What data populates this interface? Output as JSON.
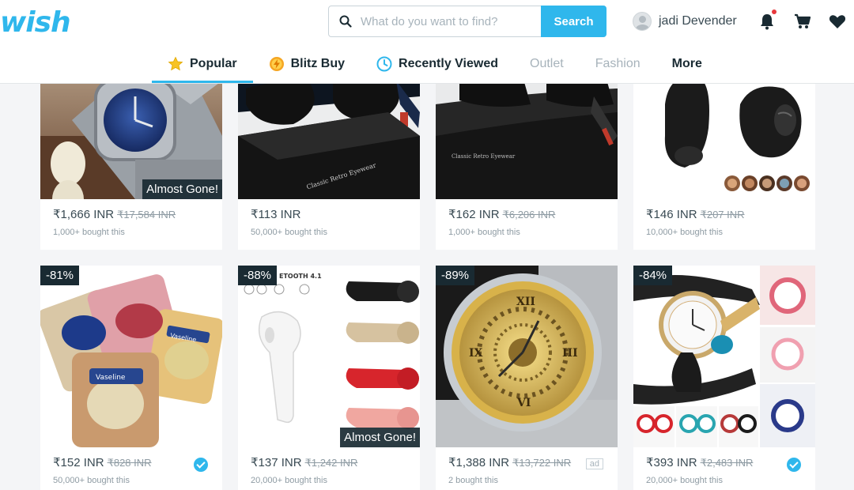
{
  "header": {
    "logo": "wish",
    "search": {
      "placeholder": "What do you want to find?",
      "button": "Search"
    },
    "user_name": "jadi Devender"
  },
  "tabs": [
    {
      "label": "Popular",
      "icon": "star-icon"
    },
    {
      "label": "Blitz Buy",
      "icon": "blitz-coin-icon"
    },
    {
      "label": "Recently Viewed",
      "icon": "clock-icon"
    },
    {
      "label": "Outlet"
    },
    {
      "label": "Fashion"
    },
    {
      "label": "More"
    }
  ],
  "products": [
    {
      "name": "watch",
      "price": "₹1,666 INR",
      "old_price": "₹17,584 INR",
      "bought": "1,000+ bought this",
      "badge": "Almost Gone!"
    },
    {
      "name": "sunglasses-box",
      "price": "₹113 INR",
      "bought": "50,000+ bought this"
    },
    {
      "name": "sunglasses-case",
      "price": "₹162 INR",
      "old_price": "₹6,206 INR",
      "bought": "1,000+ bought this"
    },
    {
      "name": "earbud",
      "price": "₹146 INR",
      "old_price": "₹207 INR",
      "bought": "10,000+ bought this"
    },
    {
      "name": "lip-therapy",
      "discount": "-81%",
      "price": "₹152 INR",
      "old_price": "₹828 INR",
      "bought": "50,000+ bought this",
      "verified": true
    },
    {
      "name": "bluetooth-earpiece",
      "discount": "-88%",
      "price": "₹137 INR",
      "old_price": "₹1,242 INR",
      "bought": "20,000+ bought this",
      "badge": "Almost Gone!",
      "img_text": "ETOOTH 4.1"
    },
    {
      "name": "skeleton-watch",
      "discount": "-89%",
      "price": "₹1,388 INR",
      "old_price": "₹13,722 INR",
      "bought": "2 bought this",
      "ad": "ad"
    },
    {
      "name": "bracelet-watch",
      "discount": "-84%",
      "price": "₹393 INR",
      "old_price": "₹2,483 INR",
      "bought": "20,000+ bought this",
      "verified": true
    }
  ],
  "colors": {
    "brand": "#2fb7ec",
    "text": "#192a32",
    "muted": "#8e9ba3",
    "alert": "#e8383d"
  }
}
